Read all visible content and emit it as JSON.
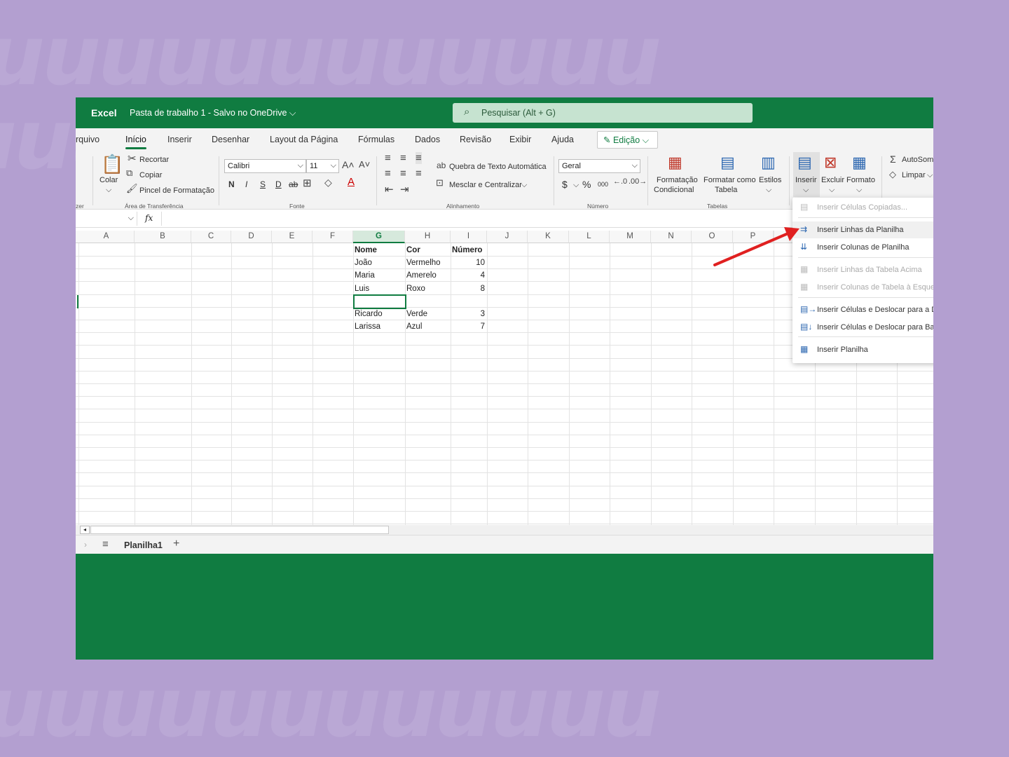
{
  "titlebar": {
    "app_name": "Excel",
    "doc_title": "Pasta de trabalho 1  -  Salvo no OneDrive ⌵",
    "search_placeholder": "Pesquisar (Alt + G)"
  },
  "tabs": [
    "rquivo",
    "Início",
    "Inserir",
    "Desenhar",
    "Layout da Página",
    "Fórmulas",
    "Dados",
    "Revisão",
    "Exibir",
    "Ajuda"
  ],
  "edit_mode": "Edição",
  "ribbon": {
    "clipboard": {
      "paste": "Colar",
      "cut": "Recortar",
      "copy": "Copiar",
      "painter": "Pincel de Formatação",
      "group": "Área de Transferência",
      "left_fragment": "zer"
    },
    "font": {
      "name": "Calibri",
      "size": "11",
      "bold": "N",
      "italic": "I",
      "underline": "S",
      "dunderline": "D",
      "strike": "ab",
      "group": "Fonte"
    },
    "alignment": {
      "wrap": "Quebra de Texto Automática",
      "merge": "Mesclar e Centralizar",
      "group": "Alinhamento"
    },
    "number": {
      "format": "Geral",
      "currency": "$",
      "percent": "%",
      "thousands": "000",
      "group": "Número"
    },
    "tables": {
      "conditional_1": "Formatação",
      "conditional_2": "Condicional",
      "format_table_1": "Formatar como",
      "format_table_2": "Tabela",
      "styles": "Estilos",
      "group": "Tabelas"
    },
    "cells": {
      "insert": "Inserir",
      "delete": "Excluir",
      "format": "Formato"
    },
    "editing": {
      "autosum": "AutoSom",
      "clear": "Limpar"
    }
  },
  "formula_bar": {
    "fx": "fx"
  },
  "columns": [
    "A",
    "B",
    "C",
    "D",
    "E",
    "F",
    "G",
    "H",
    "I",
    "J",
    "K",
    "L",
    "M",
    "N",
    "O",
    "P"
  ],
  "table": {
    "headers": [
      "Nome",
      "Cor",
      "Número"
    ],
    "rows": [
      [
        "João",
        "Vermelho",
        "10"
      ],
      [
        "Maria",
        "Amerelo",
        "4"
      ],
      [
        "Luis",
        "Roxo",
        "8"
      ],
      [
        "",
        "",
        ""
      ],
      [
        "Ricardo",
        "Verde",
        "3"
      ],
      [
        "Larissa",
        "Azul",
        "7"
      ]
    ]
  },
  "sheet_tab": "Planilha1",
  "insert_menu": [
    {
      "label": "Inserir Células Copiadas...",
      "icon": "paste-cells-icon",
      "disabled": true
    },
    {
      "label": "Inserir Linhas da Planilha",
      "icon": "insert-rows-icon",
      "disabled": false
    },
    {
      "label": "Inserir Colunas de Planilha",
      "icon": "insert-columns-icon",
      "disabled": false
    },
    {
      "label": "Inserir Linhas da Tabela Acima",
      "icon": "table-rows-icon",
      "disabled": true
    },
    {
      "label": "Inserir Colunas de Tabela à Esquer",
      "icon": "table-columns-icon",
      "disabled": true
    },
    {
      "label": "Inserir Células e Deslocar para a Di",
      "icon": "shift-right-icon",
      "disabled": false
    },
    {
      "label": "Inserir Células e Deslocar para Baix",
      "icon": "shift-down-icon",
      "disabled": false
    },
    {
      "label": "Inserir Planilha",
      "icon": "insert-sheet-icon",
      "disabled": false
    }
  ],
  "colors": {
    "excel_green": "#107c41",
    "background": "#b39fd0",
    "arrow": "#e02020"
  }
}
